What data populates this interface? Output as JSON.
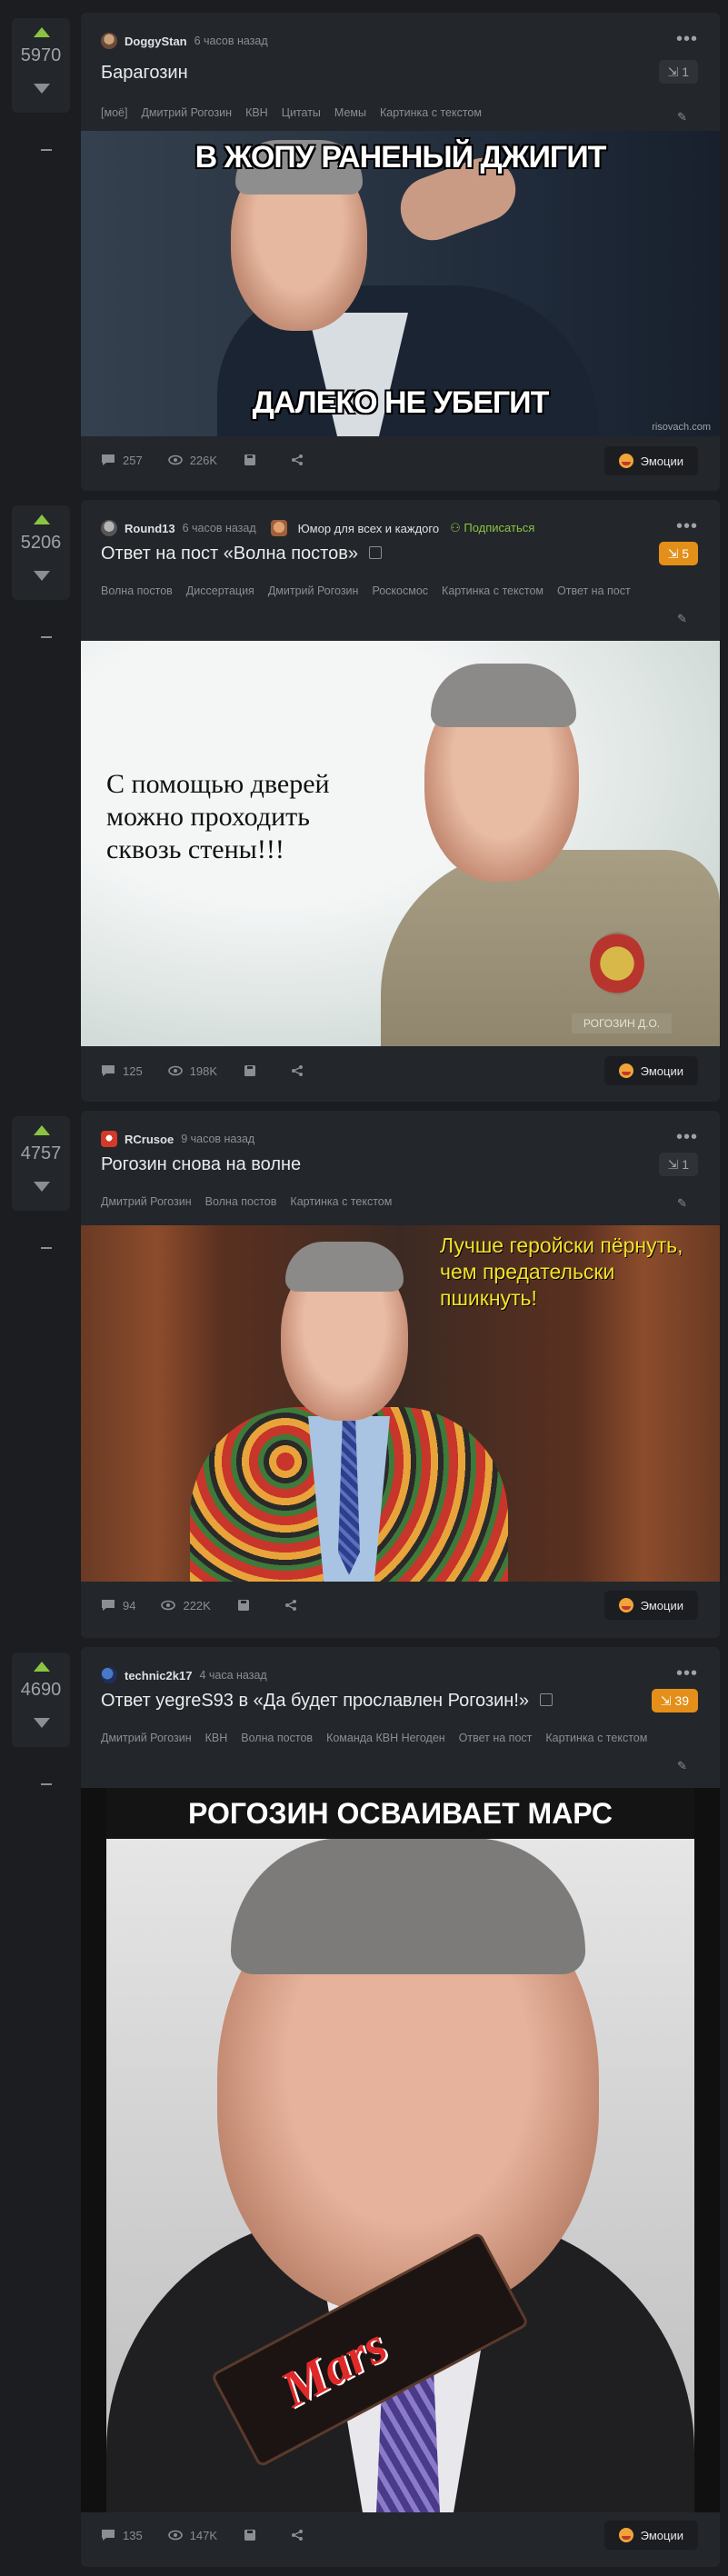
{
  "posts": [
    {
      "score": "5970",
      "author": "DoggyStan",
      "time": "6 часов назад",
      "title": "Барагозин",
      "count": "1",
      "tags": [
        "[моё]",
        "Дмитрий Рогозин",
        "КВН",
        "Цитаты",
        "Мемы",
        "Картинка с текстом"
      ],
      "meme_top": "В ЖОПУ РАНЕНЫЙ ДЖИГИТ",
      "meme_bottom": "ДАЛЕКО НЕ УБЕГИТ",
      "watermark": "risovach.com",
      "comments": "257",
      "views": "226K",
      "emotions": "Эмоции"
    },
    {
      "score": "5206",
      "author": "Round13",
      "time": "6 часов назад",
      "community": "Юмор для всех и каждого",
      "subscribe": "Подписаться",
      "title": "Ответ на пост «Волна постов»",
      "count": "5",
      "tags": [
        "Волна постов",
        "Диссертация",
        "Дмитрий Рогозин",
        "Роскосмос",
        "Картинка с текстом",
        "Ответ на пост"
      ],
      "image_text": "С помощью дверей можно проходить сквозь стены!!!",
      "badge": "РОГОЗИН Д.О.",
      "comments": "125",
      "views": "198K",
      "emotions": "Эмоции"
    },
    {
      "score": "4757",
      "author": "RCrusoe",
      "time": "9 часов назад",
      "title": "Рогозин снова на волне",
      "count": "1",
      "tags": [
        "Дмитрий Рогозин",
        "Волна постов",
        "Картинка с текстом"
      ],
      "image_text": "Лучше геройски пёрнуть, чем предательски пшикнуть!",
      "comments": "94",
      "views": "222K",
      "emotions": "Эмоции"
    },
    {
      "score": "4690",
      "author": "technic2k17",
      "time": "4 часа назад",
      "title": "Ответ yegreS93 в «Да будет прославлен Рогозин!»",
      "count": "39",
      "tags": [
        "Дмитрий Рогозин",
        "КВН",
        "Волна постов",
        "Команда КВН Негоден",
        "Ответ на пост",
        "Картинка с текстом"
      ],
      "image_text": "РОГОЗИН ОСВАИВАЕТ МАРС",
      "bar_label": "Mars",
      "comments": "135",
      "views": "147K",
      "emotions": "Эмоции"
    }
  ]
}
